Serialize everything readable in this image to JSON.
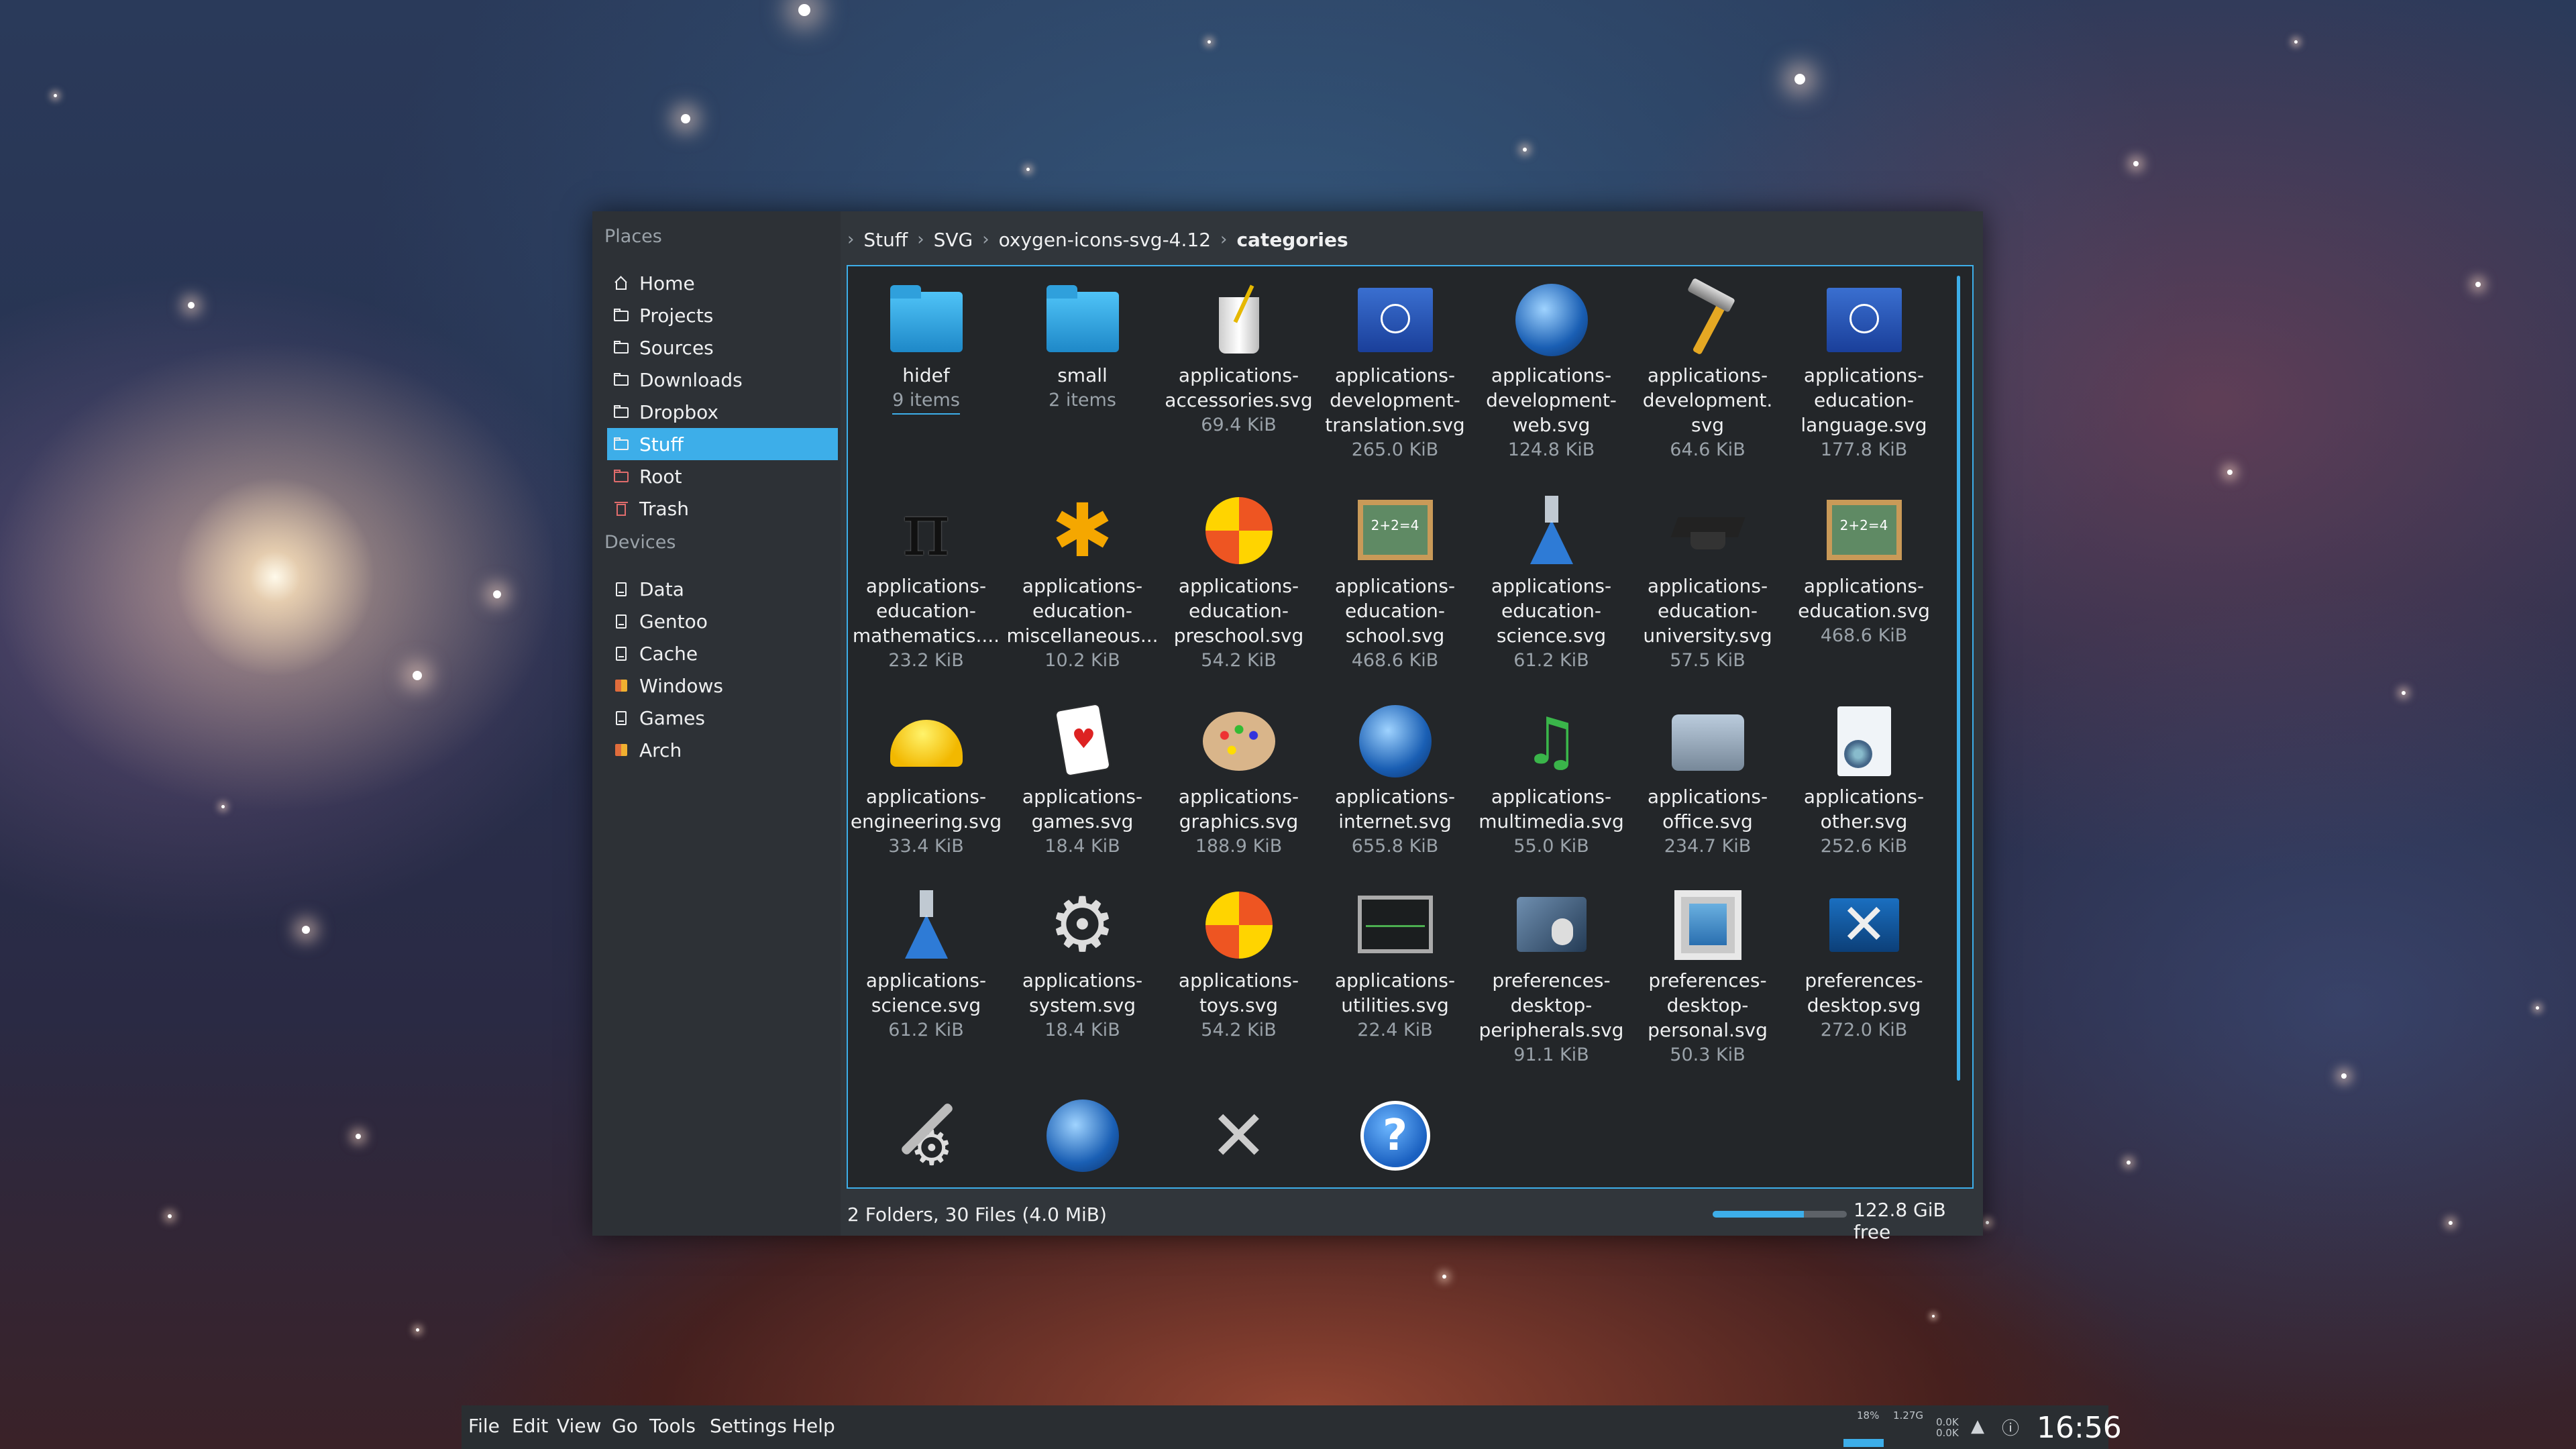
{
  "places": {
    "title": "Places",
    "items": [
      {
        "label": "Home",
        "icon": "home-icon",
        "active": false
      },
      {
        "label": "Projects",
        "icon": "folder-icon",
        "active": false
      },
      {
        "label": "Sources",
        "icon": "folder-icon",
        "active": false
      },
      {
        "label": "Downloads",
        "icon": "folder-icon",
        "active": false
      },
      {
        "label": "Dropbox",
        "icon": "folder-icon",
        "active": false
      },
      {
        "label": "Stuff",
        "icon": "folder-icon",
        "active": true
      },
      {
        "label": "Root",
        "icon": "folder-red-icon",
        "active": false
      },
      {
        "label": "Trash",
        "icon": "trash-icon",
        "active": false
      }
    ]
  },
  "devices": {
    "title": "Devices",
    "items": [
      {
        "label": "Data",
        "icon": "drive-icon"
      },
      {
        "label": "Gentoo",
        "icon": "drive-icon"
      },
      {
        "label": "Cache",
        "icon": "drive-icon"
      },
      {
        "label": "Windows",
        "icon": "windows-drive-icon"
      },
      {
        "label": "Games",
        "icon": "drive-icon"
      },
      {
        "label": "Arch",
        "icon": "windows-drive-icon"
      }
    ]
  },
  "breadcrumb": {
    "items": [
      "Stuff",
      "SVG",
      "oxygen-icons-svg-4.12",
      "categories"
    ]
  },
  "files": [
    {
      "name": "hidef",
      "size": "9 items",
      "icon": "folder-icon"
    },
    {
      "name": "small",
      "size": "2 items",
      "icon": "folder-icon"
    },
    {
      "name": "applications-accessories.svg",
      "lines": [
        "applications-",
        "accessories.svg"
      ],
      "size": "69.4 KiB",
      "icon": "cup-icon"
    },
    {
      "name": "applications-development-translation.svg",
      "lines": [
        "applications-",
        "development-",
        "translation.svg"
      ],
      "size": "265.0 KiB",
      "icon": "flag-hammer-icon"
    },
    {
      "name": "applications-development-web.svg",
      "lines": [
        "applications-",
        "development-",
        "web.svg"
      ],
      "size": "124.8 KiB",
      "icon": "globe-hammer-icon"
    },
    {
      "name": "applications-development.svg",
      "lines": [
        "applications-",
        "development.",
        "svg"
      ],
      "size": "64.6 KiB",
      "icon": "hammer-icon"
    },
    {
      "name": "applications-education-language.svg",
      "lines": [
        "applications-",
        "education-",
        "language.svg"
      ],
      "size": "177.8 KiB",
      "icon": "flag-icon"
    },
    {
      "name": "applications-education-mathematics.svg",
      "lines": [
        "applications-",
        "education-",
        "mathematics...."
      ],
      "size": "23.2 KiB",
      "icon": "pi-icon"
    },
    {
      "name": "applications-education-miscellaneous.svg",
      "lines": [
        "applications-",
        "education-",
        "miscellaneous..."
      ],
      "size": "10.2 KiB",
      "icon": "asterisk-icon"
    },
    {
      "name": "applications-education-preschool.svg",
      "lines": [
        "applications-",
        "education-",
        "preschool.svg"
      ],
      "size": "54.2 KiB",
      "icon": "ball-icon"
    },
    {
      "name": "applications-education-school.svg",
      "lines": [
        "applications-",
        "education-",
        "school.svg"
      ],
      "size": "468.6 KiB",
      "icon": "chalkboard-icon"
    },
    {
      "name": "applications-education-science.svg",
      "lines": [
        "applications-",
        "education-",
        "science.svg"
      ],
      "size": "61.2 KiB",
      "icon": "flask-icon"
    },
    {
      "name": "applications-education-university.svg",
      "lines": [
        "applications-",
        "education-",
        "university.svg"
      ],
      "size": "57.5 KiB",
      "icon": "graduation-cap-icon"
    },
    {
      "name": "applications-education.svg",
      "lines": [
        "applications-",
        "education.svg"
      ],
      "size": "468.6 KiB",
      "icon": "chalkboard-icon"
    },
    {
      "name": "applications-engineering.svg",
      "lines": [
        "applications-",
        "engineering.svg"
      ],
      "size": "33.4 KiB",
      "icon": "hard-hat-icon"
    },
    {
      "name": "applications-games.svg",
      "lines": [
        "applications-",
        "games.svg"
      ],
      "size": "18.4 KiB",
      "icon": "cards-icon"
    },
    {
      "name": "applications-graphics.svg",
      "lines": [
        "applications-",
        "graphics.svg"
      ],
      "size": "188.9 KiB",
      "icon": "palette-icon"
    },
    {
      "name": "applications-internet.svg",
      "lines": [
        "applications-",
        "internet.svg"
      ],
      "size": "655.8 KiB",
      "icon": "globe-icon"
    },
    {
      "name": "applications-multimedia.svg",
      "lines": [
        "applications-",
        "multimedia.svg"
      ],
      "size": "55.0 KiB",
      "icon": "music-icon"
    },
    {
      "name": "applications-office.svg",
      "lines": [
        "applications-",
        "office.svg"
      ],
      "size": "234.7 KiB",
      "icon": "typewriter-icon"
    },
    {
      "name": "applications-other.svg",
      "lines": [
        "applications-",
        "other.svg"
      ],
      "size": "252.6 KiB",
      "icon": "document-icon"
    },
    {
      "name": "applications-science.svg",
      "lines": [
        "applications-",
        "science.svg"
      ],
      "size": "61.2 KiB",
      "icon": "flask-icon"
    },
    {
      "name": "applications-system.svg",
      "lines": [
        "applications-",
        "system.svg"
      ],
      "size": "18.4 KiB",
      "icon": "gear-icon"
    },
    {
      "name": "applications-toys.svg",
      "lines": [
        "applications-",
        "toys.svg"
      ],
      "size": "54.2 KiB",
      "icon": "ball-icon"
    },
    {
      "name": "applications-utilities.svg",
      "lines": [
        "applications-",
        "utilities.svg"
      ],
      "size": "22.4 KiB",
      "icon": "monitor-icon"
    },
    {
      "name": "preferences-desktop-peripherals.svg",
      "lines": [
        "preferences-",
        "desktop-",
        "peripherals.svg"
      ],
      "size": "91.1 KiB",
      "icon": "tablet-icon"
    },
    {
      "name": "preferences-desktop-personal.svg",
      "lines": [
        "preferences-",
        "desktop-",
        "personal.svg"
      ],
      "size": "50.3 KiB",
      "icon": "picture-frame-icon"
    },
    {
      "name": "preferences-desktop.svg",
      "lines": [
        "preferences-",
        "desktop.svg"
      ],
      "size": "272.0 KiB",
      "icon": "desktop-tools-icon"
    },
    {
      "name": "",
      "size": "",
      "icon": "wrench-gear-icon"
    },
    {
      "name": "",
      "size": "",
      "icon": "globe-wrench-icon"
    },
    {
      "name": "",
      "size": "",
      "icon": "crossed-tools-icon"
    },
    {
      "name": "",
      "size": "",
      "icon": "help-icon"
    }
  ],
  "status": {
    "summary": "2 Folders, 30 Files (4.0 MiB)",
    "free": "122.8 GiB free",
    "used_fraction": 0.68
  },
  "menu": [
    "File",
    "Edit",
    "View",
    "Go",
    "Tools",
    "Settings",
    "Help"
  ],
  "panel": {
    "cpu": "18%",
    "mem": "1.27G",
    "net_up": "0.0K",
    "net_down": "0.0K",
    "clock": "16:56"
  }
}
